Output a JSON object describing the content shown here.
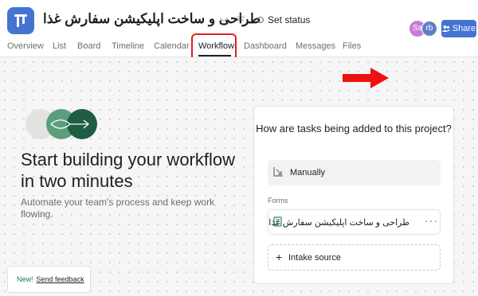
{
  "header": {
    "project_title": "طراحی و ساخت اپلیکیشن سفارش غذا",
    "set_status_label": "Set status",
    "avatars": [
      "Sa",
      "rb"
    ],
    "share_label": "Share",
    "brand_color": "#4573d2"
  },
  "tabs": [
    {
      "label": "Overview"
    },
    {
      "label": "List"
    },
    {
      "label": "Board"
    },
    {
      "label": "Timeline"
    },
    {
      "label": "Calendar"
    },
    {
      "label": "Workflow",
      "active": true
    },
    {
      "label": "Dashboard"
    },
    {
      "label": "Messages"
    },
    {
      "label": "Files"
    }
  ],
  "hero": {
    "title": "Start building your workflow in two minutes",
    "subtitle": "Automate your team's process and keep work flowing."
  },
  "card": {
    "title": "How are tasks being added to this project?",
    "manual_label": "Manually",
    "forms_label": "Forms",
    "form_name": "طراحی و ساخت اپلیکیشن سفارش غذا",
    "more_label": "···",
    "intake_label": "Intake source"
  },
  "feedback": {
    "new_label": "New!",
    "link_label": "Send feedback"
  },
  "annotation": {
    "highlight_color": "#e02020",
    "arrow_color": "#ee1111"
  }
}
